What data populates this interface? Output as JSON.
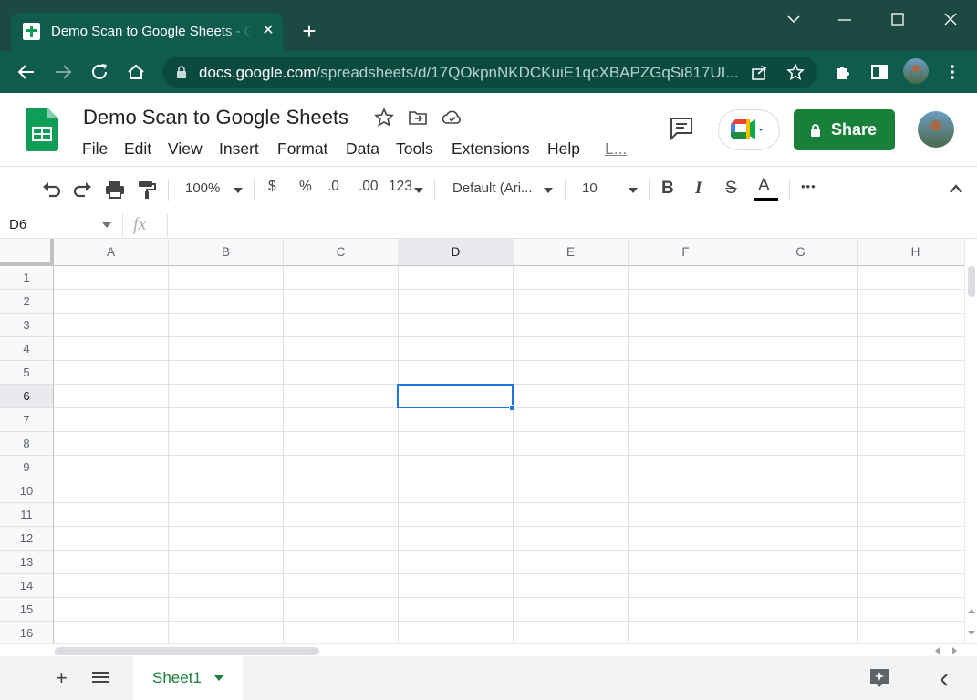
{
  "browser": {
    "tab_title": "Demo Scan to Google Sheets - Google Sheets",
    "tab_close": "✕",
    "new_tab": "+",
    "url_host": "docs.google.com",
    "url_path": "/spreadsheets/d/17QOkpnNKDCKuiE1qcXBAPZGqSi817UI..."
  },
  "doc": {
    "title": "Demo Scan to Google Sheets",
    "menu": [
      "File",
      "Edit",
      "View",
      "Insert",
      "Format",
      "Data",
      "Tools",
      "Extensions",
      "Help",
      "L..."
    ],
    "share_label": "Share"
  },
  "toolbar": {
    "zoom": "100%",
    "currency": "$",
    "percent": "%",
    "decrease_decimal": ".0",
    "increase_decimal": ".00",
    "more_formats": "123",
    "font": "Default (Ari...",
    "font_size": "10",
    "bold": "B",
    "italic": "I",
    "strikethrough": "S",
    "text_color": "A",
    "more": "•••"
  },
  "formula_bar": {
    "name_box": "D6",
    "fx": "fx",
    "value": ""
  },
  "grid": {
    "columns": [
      "A",
      "B",
      "C",
      "D",
      "E",
      "F",
      "G",
      "H"
    ],
    "rows": [
      "1",
      "2",
      "3",
      "4",
      "5",
      "6",
      "7",
      "8",
      "9",
      "10",
      "11",
      "12",
      "13",
      "14",
      "15",
      "16"
    ],
    "selected_cell": "D6"
  },
  "sheets": {
    "add": "+",
    "active_sheet": "Sheet1"
  },
  "colors": {
    "chrome_frame": "#1c4a43",
    "chrome_toolbar": "#0f5c4e",
    "share_green": "#188038",
    "selection_blue": "#1a73e8"
  }
}
